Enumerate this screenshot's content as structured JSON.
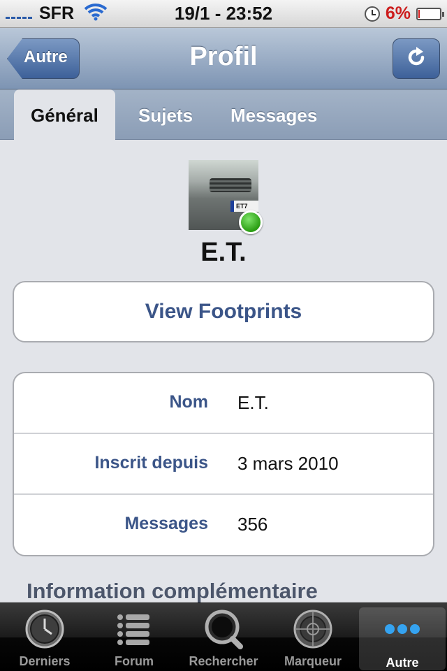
{
  "status_bar": {
    "carrier": "SFR",
    "time": "19/1 - 23:52",
    "battery_percent": "6%",
    "battery_level": 0.06,
    "icons": [
      "signal-icon",
      "wifi-icon",
      "alarm-icon",
      "battery-icon"
    ]
  },
  "nav_bar": {
    "title": "Profil",
    "back_label": "Autre",
    "right_icon": "refresh-icon"
  },
  "segment_tabs": [
    {
      "label": "Général",
      "active": true
    },
    {
      "label": "Sujets",
      "active": false
    },
    {
      "label": "Messages",
      "active": false
    }
  ],
  "profile": {
    "username": "E.T.",
    "avatar_plate_text": "ET7",
    "online": true
  },
  "footprints_button": "View Footprints",
  "info_rows": [
    {
      "label": "Nom",
      "value": "E.T."
    },
    {
      "label": "Inscrit depuis",
      "value": "3 mars 2010"
    },
    {
      "label": "Messages",
      "value": "356"
    }
  ],
  "section_header": "Information complémentaire",
  "bottom_tabs": [
    {
      "label": "Derniers",
      "icon": "clock-icon",
      "active": false
    },
    {
      "label": "Forum",
      "icon": "list-icon",
      "active": false
    },
    {
      "label": "Rechercher",
      "icon": "magnifier-icon",
      "active": false
    },
    {
      "label": "Marqueur",
      "icon": "radar-icon",
      "active": false
    },
    {
      "label": "Autre",
      "icon": "more-dots-icon",
      "active": true
    }
  ],
  "colors": {
    "accent_blue": "#3b5588",
    "online_green": "#2a9d12",
    "battery_red": "#d21c1c"
  }
}
